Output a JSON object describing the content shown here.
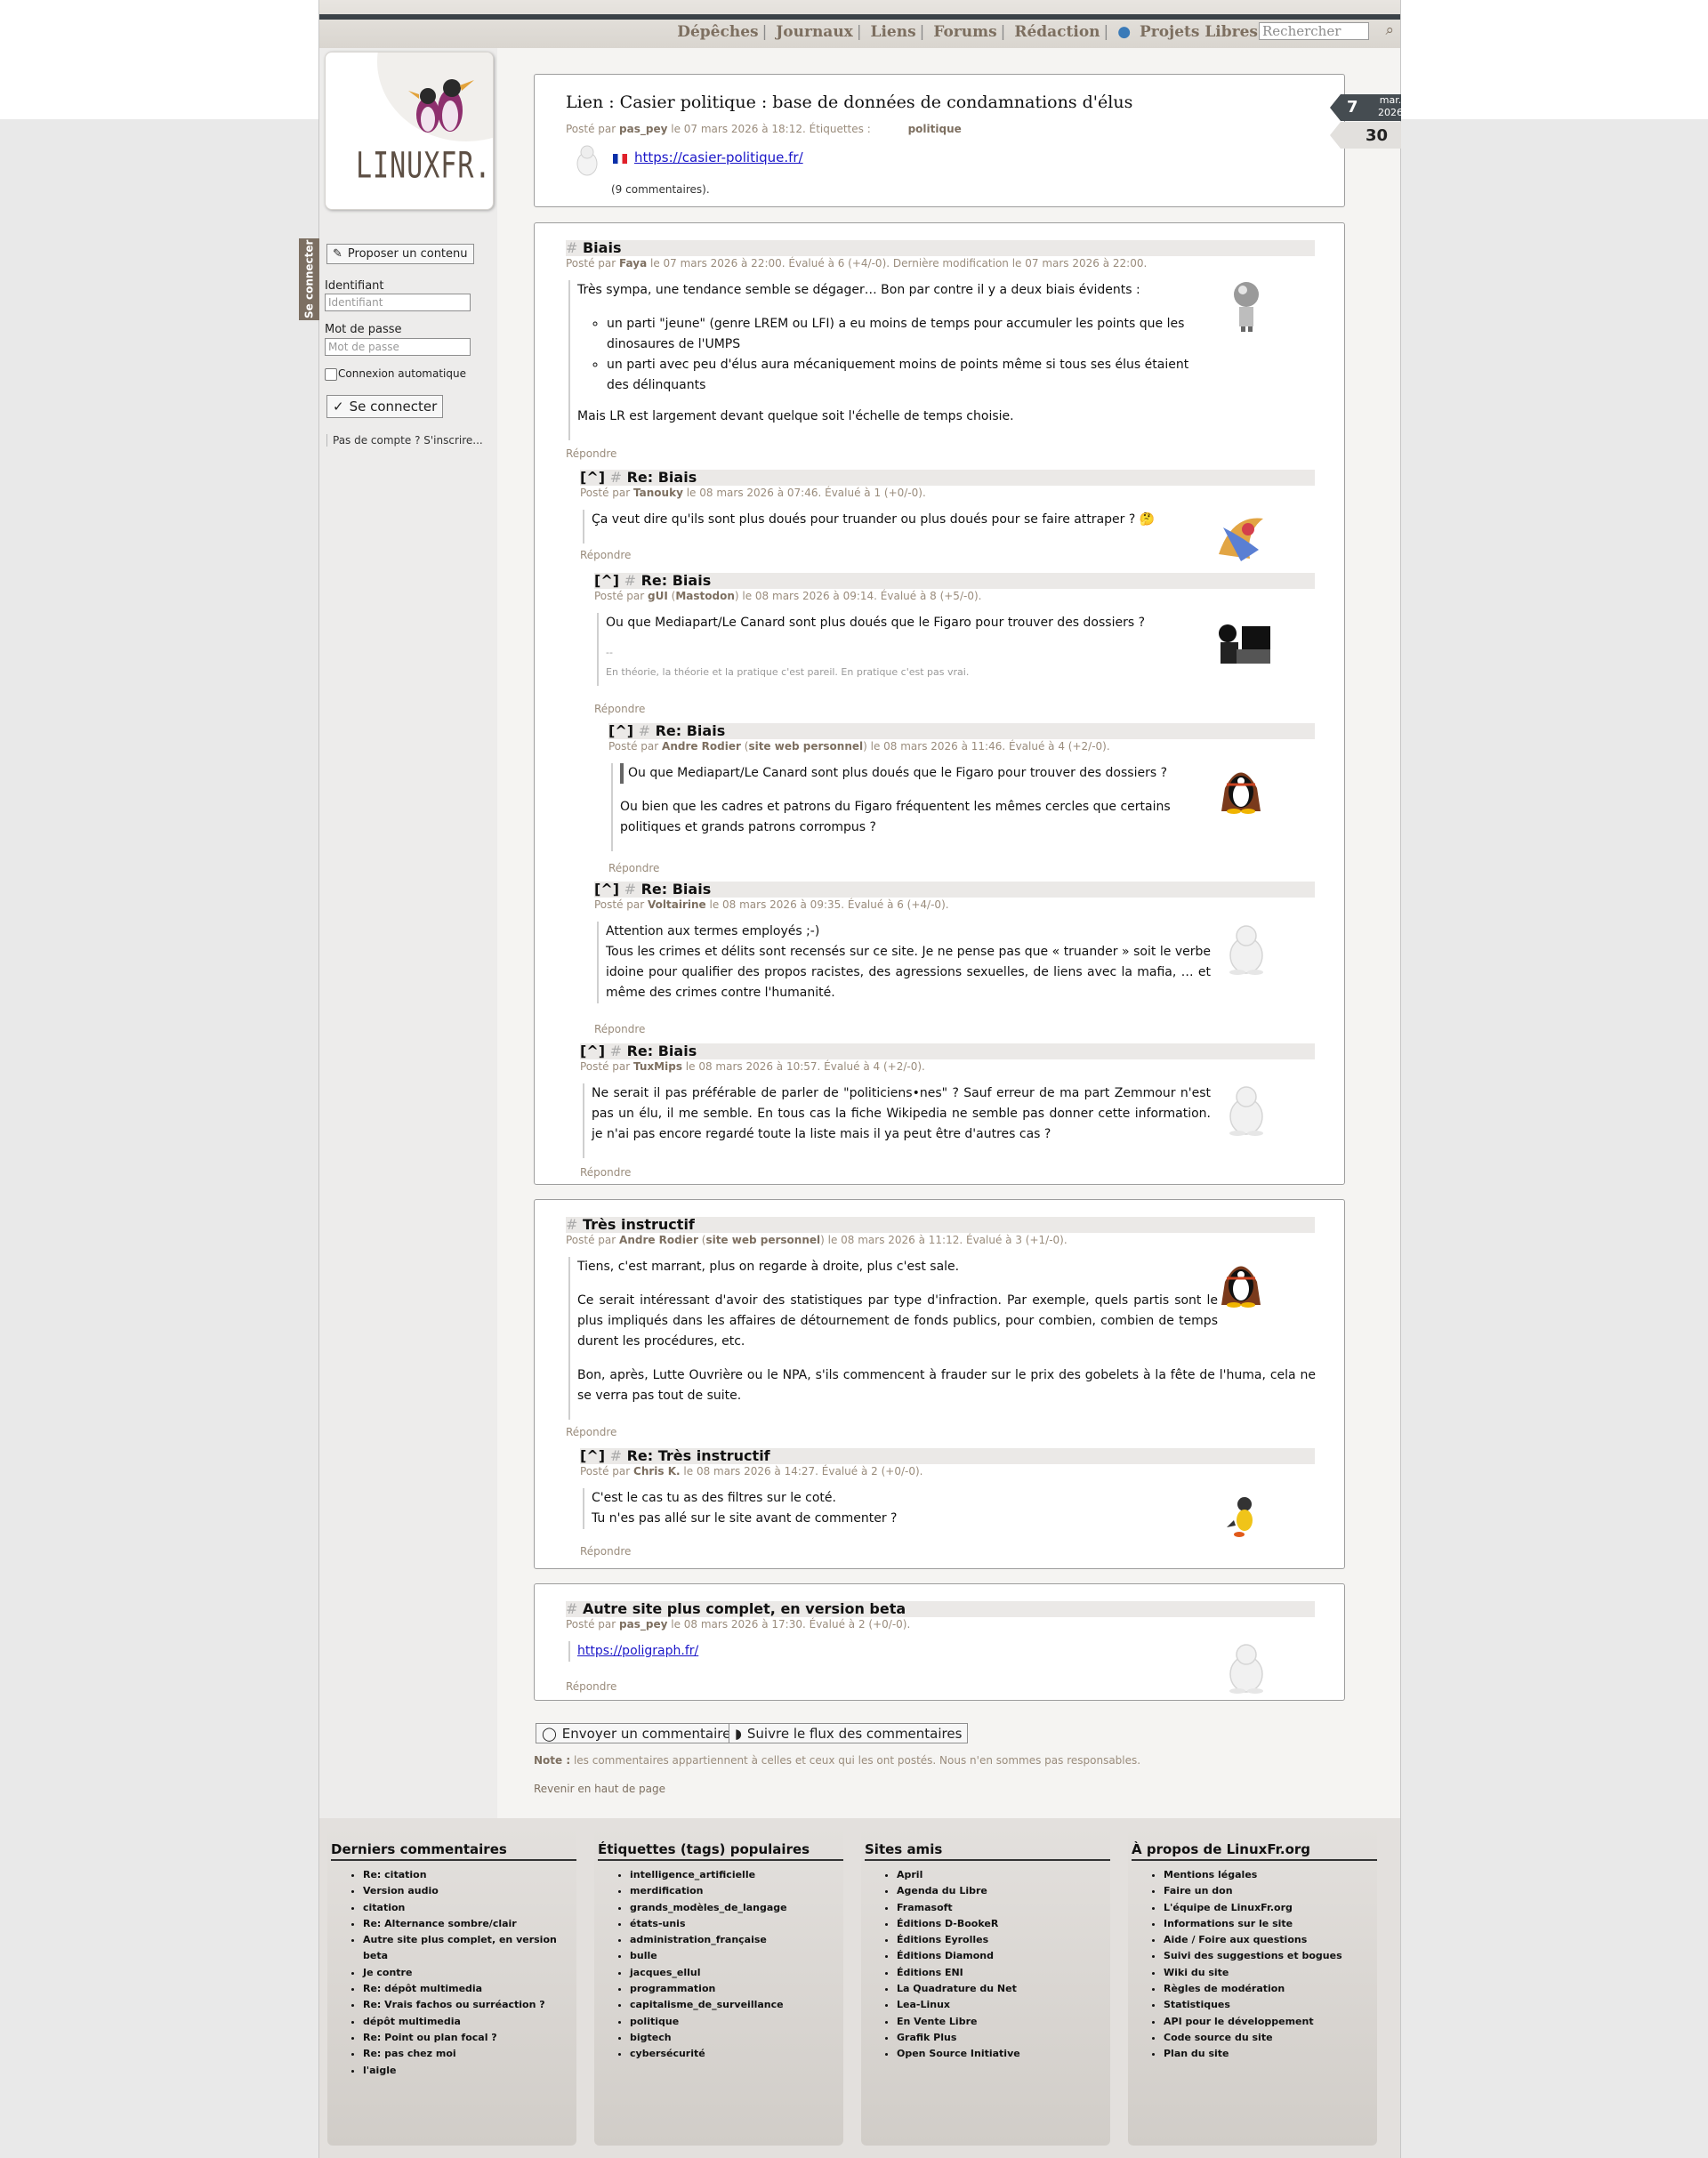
{
  "nav": {
    "items": [
      "Dépêches",
      "Journaux",
      "Liens",
      "Forums",
      "Rédaction",
      "Projets Libres"
    ],
    "search_placeholder": "Rechercher"
  },
  "logo_text": "LINUXFR.ORG",
  "sidebar": {
    "login_tab": "Se connecter",
    "propose": "Proposer un contenu",
    "id_label": "Identifiant",
    "id_placeholder": "Identifiant",
    "pw_label": "Mot de passe",
    "pw_placeholder": "Mot de passe",
    "auto": "Connexion automatique",
    "connect": "Se connecter",
    "signup": "Pas de compte ? S'inscrire..."
  },
  "news": {
    "title": "Lien : Casier politique : base de données de condamnations d'élus",
    "meta_pre": "Posté par ",
    "author": "pas_pey",
    "meta_post": " le 07 mars 2026 à 18:12. Étiquettes :",
    "tag": "politique",
    "link": "https://casier-politique.fr/",
    "comments": "(9 commentaires).",
    "date": {
      "day": "7",
      "month": "mar.",
      "year": "2026",
      "count": "30"
    }
  },
  "reply_label": "Répondre",
  "parent_link": "[^]",
  "comments": [
    {
      "title": "Biais",
      "author": "Faya",
      "extra": "",
      "meta": " le 07 mars 2026 à 22:00. Évalué à 6 (+4/-0). Dernière modification le 07 mars 2026 à 22:00.",
      "p1": "Très sympa, une tendance semble se dégager… Bon par contre il y a deux biais évidents :",
      "li1": "un parti \"jeune\" (genre LREM ou LFI) a eu moins de temps pour accumuler les points que les dino­saures de l'UMPS",
      "li2": "un parti avec peu d'élus aura mécaniquement moins de points même si tous ses élus étaient des délinquants",
      "p2": "Mais LR est largement devant quelque soit l'échelle de temps choisie."
    },
    {
      "title": "Re: Biais",
      "author": "Tanouky",
      "meta": " le 08 mars 2026 à 07:46. Évalué à 1 (+0/-0).",
      "p1": "Ça veut dire qu'ils sont plus doués pour truander ou plus doués pour se faire attraper ? 🤔"
    },
    {
      "title": "Re: Biais",
      "author": "gUI",
      "extra": "Mastodon",
      "meta": " le 08 mars 2026 à 09:14. Évalué à 8 (+5/-0).",
      "p1": "Ou que Mediapart/Le Canard sont plus doués que le Figaro pour trouver des dossiers ?",
      "dash": "--",
      "sig": "En théorie, la théorie et la pratique c'est pareil. En pratique c'est pas vrai."
    },
    {
      "title": "Re: Biais",
      "author": "Andre Rodier",
      "extra": "site web personnel",
      "meta": " le 08 mars 2026 à 11:46. Évalué à 4 (+2/-0).",
      "quote": "Ou que Mediapart/Le Canard sont plus doués que le Figaro pour trouver des dossiers ?",
      "p1": "Ou bien que les cadres et patrons du Figaro fréquentent les mêmes cercles que certains politiques et grands patrons corrompus ?"
    },
    {
      "title": "Re: Biais",
      "author": "Voltairine",
      "meta": " le 08 mars 2026 à 09:35. Évalué à 6 (+4/-0).",
      "l1": "Attention aux termes employés ;-)",
      "l2": "Tous les crimes et délits sont recensés sur ce site. Je ne pense pas que « truander » soit le verbe idoine pour qualifier des propos racistes, des agressions sexuelles, de liens avec la mafia, … et même des crimes contre l'humanité."
    },
    {
      "title": "Re: Biais",
      "author": "TuxMips",
      "meta": " le 08 mars 2026 à 10:57. Évalué à 4 (+2/-0).",
      "p1": "Ne serait il pas préférable de parler de \"politiciens•nes\" ? Sauf erreur de ma part Zemmour n'est pas un élu, il me semble. En tous cas la fiche Wikipedia ne semble pas donner cette information. je n'ai pas encore regardé toute la liste mais il ya peut être d'autres cas ?"
    },
    {
      "title": "Très instructif",
      "author": "Andre Rodier",
      "extra": "site web personnel",
      "meta": " le 08 mars 2026 à 11:12. Évalué à 3 (+1/-0).",
      "p1": "Tiens, c'est marrant, plus on regarde à droite, plus c'est sale.",
      "p2": "Ce serait intéressant d'avoir des statistiques par type d'infraction. Par exemple, quels partis sont le plus impliqués dans les affaires de détournement de fonds publics, pour combien, combien de temps durent les procédures, etc.",
      "p3": "Bon, après, Lutte Ouvrière ou le NPA, s'ils commencent à frauder sur le prix des gobelets à la fête de l'huma, cela ne se verra pas tout de suite."
    },
    {
      "title": "Re: Très instructif",
      "author": "Chris K.",
      "meta": " le 08 mars 2026 à 14:27. Évalué à 2 (+0/-0).",
      "l1": "C'est le cas tu as des filtres sur le coté.",
      "l2": "Tu n'es pas allé sur le site avant de commenter ?"
    },
    {
      "title": "Autre site plus complet, en version beta",
      "author": "pas_pey",
      "meta": " le 08 mars 2026 à 17:30. Évalué à 2 (+0/-0).",
      "link": "https://poligraph.fr/"
    }
  ],
  "meta_pre": "Posté par ",
  "bottom": {
    "send": "Envoyer un commentaire",
    "follow": "Suivre le flux des commentaires",
    "note_label": "Note :",
    "note": " les commentaires appartiennent à celles et ceux qui les ont postés. Nous n'en sommes pas responsables.",
    "top": "Revenir en haut de page"
  },
  "footer": {
    "col1": {
      "title": "Derniers commentaires",
      "items": [
        "Re: citation",
        "Version audio",
        "citation",
        "Re: Alternance sombre/clair",
        "Autre site plus complet, en version beta",
        "Je contre",
        "Re: dépôt multimedia",
        "Re: Vrais fachos ou surréaction ?",
        "dépôt multimedia",
        "Re: Point ou plan focal ?",
        "Re: pas chez moi",
        "l'aigle"
      ]
    },
    "col2": {
      "title": "Étiquettes (tags) populaires",
      "items": [
        "intelligence_artificielle",
        "merdification",
        "grands_modèles_de_langage",
        "états-unis",
        "administration_française",
        "bulle",
        "jacques_ellul",
        "programmation",
        "capitalisme_de_surveillance",
        "politique",
        "bigtech",
        "cybersécurité"
      ]
    },
    "col3": {
      "title": "Sites amis",
      "items": [
        "April",
        "Agenda du Libre",
        "Framasoft",
        "Éditions D-BookeR",
        "Éditions Eyrolles",
        "Éditions Diamond",
        "Éditions ENI",
        "La Quadrature du Net",
        "Lea-Linux",
        "En Vente Libre",
        "Grafik Plus",
        "Open Source Initiative"
      ]
    },
    "col4": {
      "title": "À propos de LinuxFr.org",
      "items": [
        "Mentions légales",
        "Faire un don",
        "L'équipe de LinuxFr.org",
        "Informations sur le site",
        "Aide / Foire aux questions",
        "Suivi des suggestions et bogues",
        "Wiki du site",
        "Règles de modération",
        "Statistiques",
        "API pour le développement",
        "Code source du site",
        "Plan du site"
      ]
    }
  }
}
